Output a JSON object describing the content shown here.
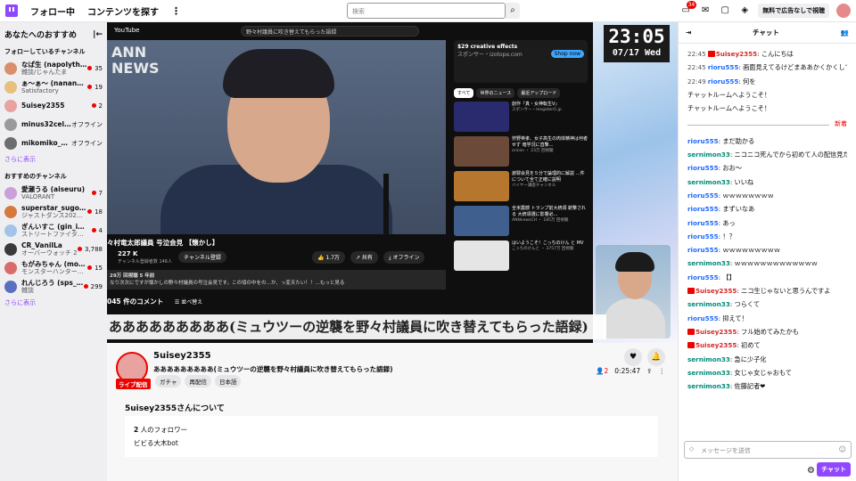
{
  "topbar": {
    "following": "フォロー中",
    "browse": "コンテンツを探す",
    "more": "⋮",
    "search_placeholder": "検索",
    "notification_count": "34",
    "ad_free": "無料で広告なしで視聴"
  },
  "sidebar": {
    "title": "あなたへのおすすめ",
    "following_header": "フォローしているチャンネル",
    "show_more": "さらに表示",
    "recommended_header": "おすすめのチャンネル",
    "following": [
      {
        "name": "なぱ生 (napolythm)",
        "game": "雑談/じゃんたま",
        "viewers": "35",
        "live": true,
        "color": "#d98f6b"
      },
      {
        "name": "ぁ～ぁ～ (nanana5…",
        "game": "Satisfactory",
        "viewers": "19",
        "live": true,
        "color": "#e6c07c"
      },
      {
        "name": "5uisey2355",
        "game": "",
        "viewers": "2",
        "live": true,
        "color": "#e8a3a0"
      },
      {
        "name": "minus32celsius",
        "game": "",
        "viewers": "オフライン",
        "live": false,
        "color": "#9a9a9a"
      },
      {
        "name": "mikomiko_ovo",
        "game": "",
        "viewers": "オフライン",
        "live": false,
        "color": "#6d6d6d"
      }
    ],
    "recommended": [
      {
        "name": "愛瀬うる (aiseuru)",
        "game": "VALORANT",
        "viewers": "7",
        "color": "#c9a0d8"
      },
      {
        "name": "superstar_sugoko…",
        "game": "ジャストダンス202…",
        "viewers": "18",
        "color": "#d67a3b"
      },
      {
        "name": "ぎんいすこ (gin_i…",
        "game": "ストリートファイタ…",
        "viewers": "4",
        "color": "#a3c4e8"
      },
      {
        "name": "CR_VanilLa",
        "game": "オーバーウォッチ 2",
        "viewers": "3,788",
        "color": "#3a3a3a"
      },
      {
        "name": "もがみちゃん (mog…",
        "game": "モンスターハンター…",
        "viewers": "15",
        "color": "#d86b6b"
      },
      {
        "name": "れんじろう (sps_r…",
        "game": "雑談",
        "viewers": "299",
        "color": "#5b6fbf"
      }
    ]
  },
  "video": {
    "yt_logo": "YouTube",
    "yt_search": "野々村議員に吹き替えてもらった語録",
    "ann": [
      "ANN",
      "NEWS"
    ],
    "title": "々村竜太郎議員 号泣会見 【懐かし】",
    "channel": "227 K",
    "subs": "チャンネル登録者数 146人",
    "subscribe_btn": "チャンネル登録",
    "likes": "1.7万",
    "share": "共有",
    "offline": "オフライン",
    "desc_line1": "29万 回視聴 5 年前",
    "desc_line2": "なり次次にですが懐かしの野々村議員の号泣会見です。この頃の中をの…か、っ変天たい！！…もっと見る",
    "comments": "045 件のコメント",
    "sort": "並べ替え",
    "ad_title": "$29 creative effects",
    "ad_sub": "スポンサー・izotope.com",
    "ad_btn": "Shop now",
    "tabs": [
      "すべて",
      "世界のニュース",
      "最近アップロード"
    ],
    "suggestions": [
      {
        "title": "創作『真・女神転生V』",
        "channel": "スポンサー・megaten5.jp",
        "color": "#2a2a6e"
      },
      {
        "title": "狩野英孝、女子高生の肉体精神は何者せず 暗学況に直撃…",
        "channel": "oricon ・ 23万 回視聴",
        "color": "#6b4a3a"
      },
      {
        "title": "謝罪会見を５分で論理的に解説 …件について全て正確に説明",
        "channel": "バイヤー講座チャンネル",
        "color": "#b7762e"
      },
      {
        "title": "全米震撼 トランプ前大統領 銃撃される 大統領選に影響必…",
        "channel": "ANNnewsCH ・ 185万 回視聴",
        "color": "#3f5f8f"
      },
      {
        "title": "はいようこそ！こっちのけん と MV",
        "channel": "こっちのけんと ・ 3757万 回視聴",
        "color": "#e5e5e5"
      }
    ],
    "clock_time": "23:05",
    "clock_date": "07/17 Wed",
    "marquee": "あああああああああ(ミュウツーの逆襲を野々村議員に吹き替えてもらった語録)"
  },
  "stream": {
    "name": "5uisey2355",
    "live_label": "ライブ配信",
    "title": "あああああああああ(ミュウツーの逆襲を野々村議員に吹き替えてもらった語録)",
    "tags": [
      "ガチャ",
      "再配信",
      "日本語"
    ],
    "viewers": "2",
    "uptime": "0:25:47",
    "about": "5uisey2355さんについて",
    "followers": "2",
    "followers_label": "人のフォロワー",
    "bio": "ビビる大木bot"
  },
  "chat": {
    "header": "チャット",
    "new_label": "新着",
    "input_placeholder": "メッセージを送信",
    "send": "チャット",
    "messages": [
      {
        "ts": "22:45",
        "user": "5uisey2355",
        "badge": true,
        "text": "こんにちは",
        "color": "u-red"
      },
      {
        "ts": "22:45",
        "user": "rioru555",
        "text": "画面見えてるけどまああかくかくしてる",
        "color": "u-blue"
      },
      {
        "ts": "22:49",
        "user": "rioru555",
        "text": "何を",
        "color": "u-blue"
      },
      {
        "ts": "",
        "user": "",
        "text": "チャットルームへようこそ！",
        "color": ""
      },
      {
        "ts": "",
        "user": "",
        "text": "チャットルームへようこそ！",
        "color": ""
      }
    ],
    "messages2": [
      {
        "user": "rioru555",
        "text": "まだ助かる",
        "color": "u-blue"
      },
      {
        "user": "sernimon33",
        "text": "ニコニコ死んでから初めて人の配信見た",
        "color": "u-teal"
      },
      {
        "user": "rioru555",
        "text": "おお～",
        "color": "u-blue"
      },
      {
        "user": "sernimon33",
        "text": "いいね",
        "color": "u-teal"
      },
      {
        "user": "rioru555",
        "text": "ｗｗｗｗｗｗｗｗ",
        "color": "u-blue"
      },
      {
        "user": "rioru555",
        "text": "まずいなあ",
        "color": "u-blue"
      },
      {
        "user": "rioru555",
        "text": "あっ",
        "color": "u-blue"
      },
      {
        "user": "rioru555",
        "text": "！？",
        "color": "u-blue"
      },
      {
        "user": "rioru555",
        "text": "ｗｗｗｗｗｗｗｗｗ",
        "color": "u-blue"
      },
      {
        "user": "sernimon33",
        "text": "ｗｗｗｗｗｗｗｗｗｗｗｗｗ",
        "color": "u-teal"
      },
      {
        "user": "rioru555",
        "text": "【】",
        "color": "u-blue"
      },
      {
        "user": "5uisey2355",
        "badge": true,
        "text": "ニコ生じゃないと思うんですよ",
        "color": "u-red"
      },
      {
        "user": "sernimon33",
        "text": "つらくて",
        "color": "u-teal"
      },
      {
        "user": "rioru555",
        "text": "抑えて！",
        "color": "u-blue"
      },
      {
        "user": "5uisey2355",
        "badge": true,
        "text": "フル始めてみたかも",
        "color": "u-red"
      },
      {
        "user": "5uisey2355",
        "badge": true,
        "text": "初めて",
        "color": "u-red"
      },
      {
        "user": "sernimon33",
        "text": "急に少子化",
        "color": "u-teal"
      },
      {
        "user": "sernimon33",
        "text": "女じゃ女じゃおもて",
        "color": "u-teal"
      },
      {
        "user": "sernimon33",
        "text": "佐藤記者❤",
        "color": "u-teal"
      }
    ]
  }
}
